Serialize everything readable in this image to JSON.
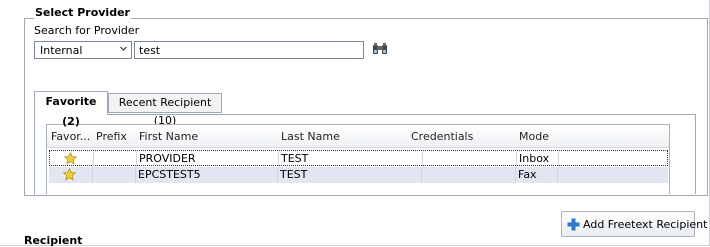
{
  "section_title": "Select Provider",
  "search": {
    "label": "Search for Provider",
    "scope_selected": "Internal",
    "value": "test"
  },
  "tabs": [
    {
      "label": "Favorite (2)",
      "active": true
    },
    {
      "label": "Recent Recipient (10)",
      "active": false
    }
  ],
  "table": {
    "columns": [
      "Favor...",
      "Prefix",
      "First Name",
      "Last Name",
      "Credentials",
      "Mode"
    ],
    "rows": [
      {
        "favorite": true,
        "prefix": "",
        "first_name": "PROVIDER",
        "last_name": "TEST",
        "credentials": "",
        "mode": "Inbox"
      },
      {
        "favorite": true,
        "prefix": "",
        "first_name": "EPCSTEST5",
        "last_name": "TEST",
        "credentials": "",
        "mode": "Fax"
      }
    ]
  },
  "add_button_label": "Add Freetext Recipient",
  "recipient_label": "Recipient",
  "icons": {
    "search": "binoculars-icon",
    "favorite": "star-icon",
    "add": "plus-icon",
    "dropdown": "chevron-down-icon"
  },
  "colors": {
    "selected_row": "#e3e5f3",
    "star": "#f2d23c",
    "plus": "#2f78c4"
  }
}
